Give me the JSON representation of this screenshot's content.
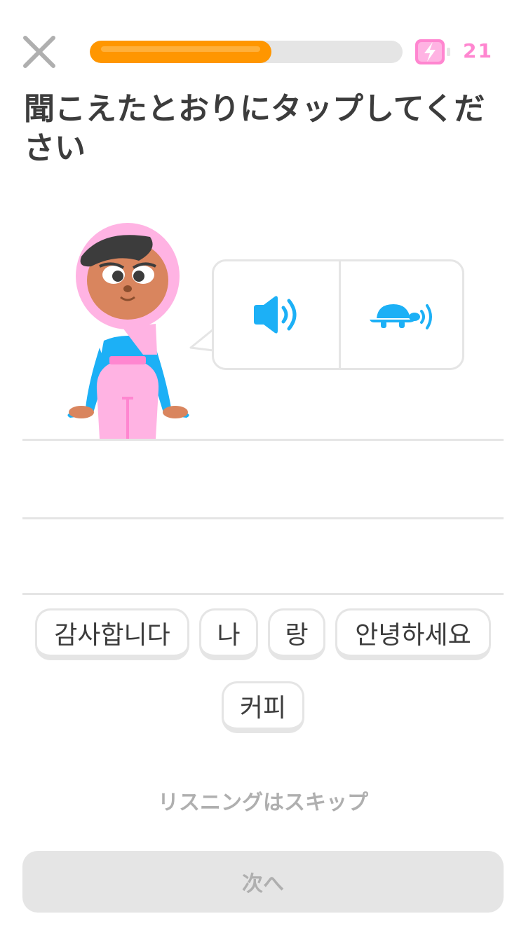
{
  "header": {
    "close_icon": "close-icon",
    "progress": 0.58,
    "energy_icon": "battery-lightning-icon",
    "energy_count": "21",
    "colors": {
      "progress": "#ff9600",
      "energy": "#ff86d0"
    }
  },
  "title": "聞こえたとおりにタップしてください",
  "audio": {
    "play_icon": "speaker-icon",
    "slow_icon": "turtle-icon",
    "accent": "#1cb0f6"
  },
  "word_bank": [
    "감사합니다",
    "나",
    "랑",
    "안녕하세요",
    "커피"
  ],
  "skip_label": "リスニングはスキップ",
  "next_label": "次へ"
}
